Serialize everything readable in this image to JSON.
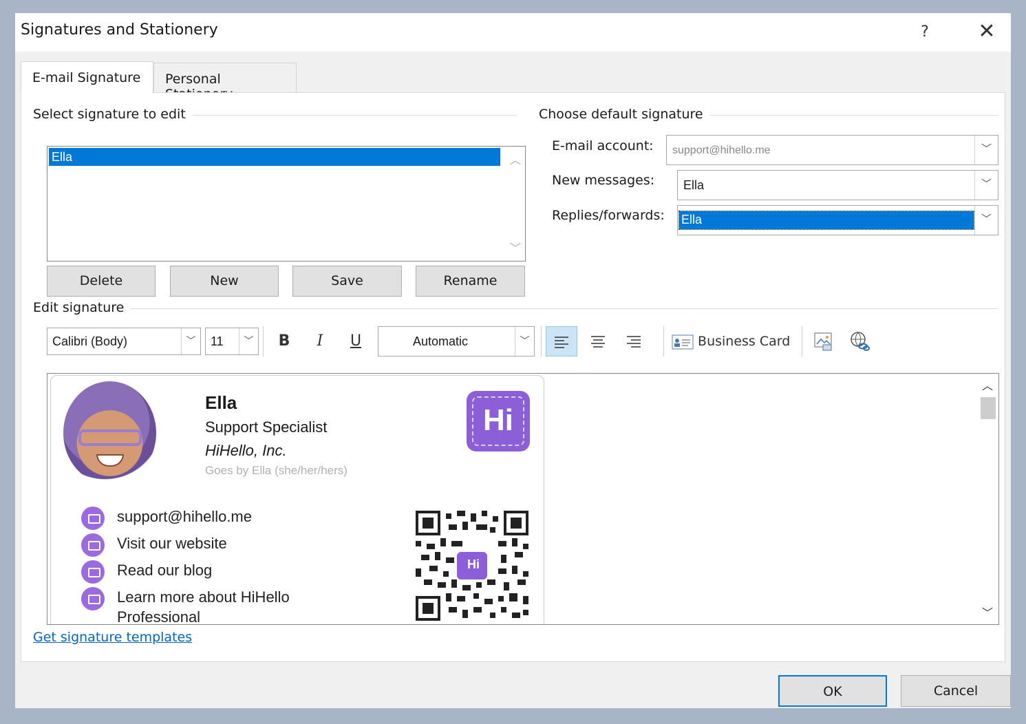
{
  "dialog": {
    "title": "Signatures and Stationery",
    "help_label": "?",
    "close_label": "✕"
  },
  "tabs": [
    {
      "label": "E-mail Signature",
      "active": true
    },
    {
      "label": "Personal Stationery",
      "active": false
    }
  ],
  "select_group": {
    "label": "Select signature to edit",
    "items": [
      "Ella"
    ],
    "selected": "Ella",
    "buttons": {
      "delete": "Delete",
      "new": "New",
      "save": "Save",
      "rename": "Rename"
    }
  },
  "default_group": {
    "label": "Choose default signature",
    "email_account_label": "E-mail account:",
    "email_account_value": "support@hihello.me",
    "new_messages_label": "New messages:",
    "new_messages_value": "Ella",
    "replies_label": "Replies/forwards:",
    "replies_value": "Ella"
  },
  "edit_group": {
    "label": "Edit signature",
    "font": "Calibri (Body)",
    "size": "11",
    "bold": "B",
    "italic": "I",
    "underline": "U",
    "color": "Automatic",
    "business_card": "Business Card"
  },
  "signature": {
    "name": "Ella",
    "role": "Support Specialist",
    "company": "HiHello, Inc.",
    "pronouns": "Goes by Ella (she/her/hers)",
    "logo_text": "Hi",
    "contacts": [
      "support@hihello.me",
      "Visit our website",
      "Read our blog",
      "Learn more about HiHello"
    ],
    "contacts_wrap": "Professional",
    "qr_logo_text": "Hi"
  },
  "footer": {
    "templates_link": "Get signature templates",
    "ok": "OK",
    "cancel": "Cancel"
  },
  "colors": {
    "accent": "#0078d7",
    "brand": "#8c5fd9",
    "link": "#0066cc"
  }
}
